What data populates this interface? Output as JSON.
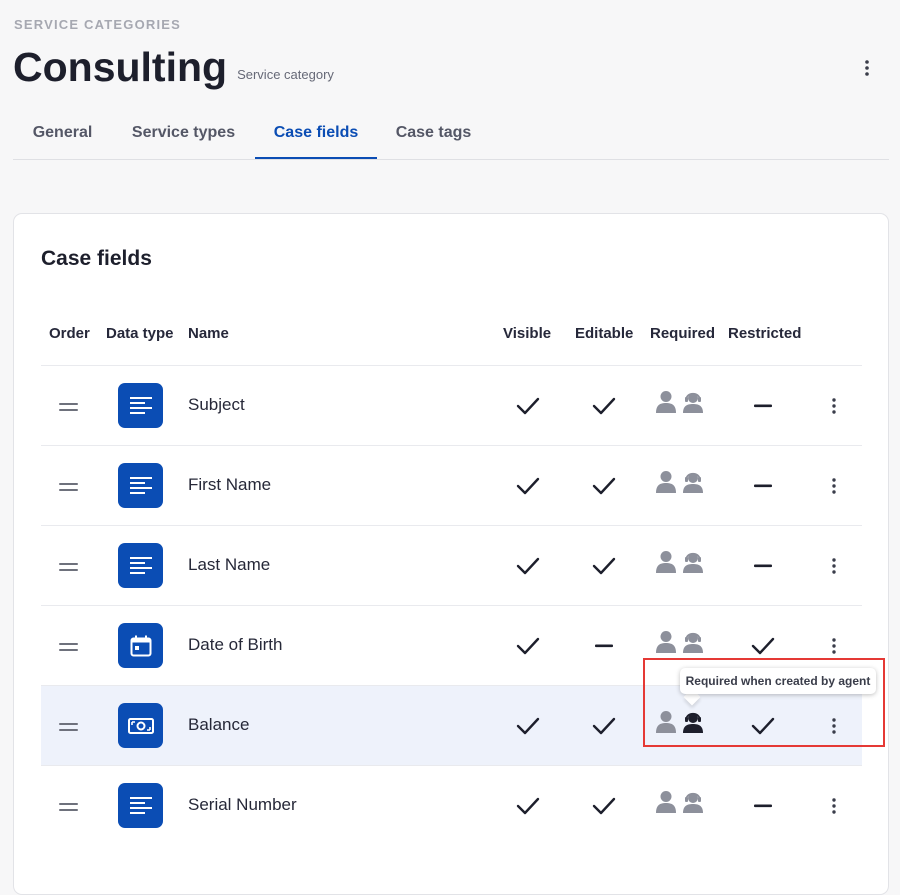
{
  "header": {
    "eyebrow": "SERVICE CATEGORIES",
    "title": "Consulting",
    "subtitle": "Service category"
  },
  "tabs": [
    {
      "label": "General",
      "active": false
    },
    {
      "label": "Service types",
      "active": false
    },
    {
      "label": "Case fields",
      "active": true
    },
    {
      "label": "Case tags",
      "active": false
    }
  ],
  "card": {
    "title": "Case fields",
    "columns": {
      "order": "Order",
      "data_type": "Data type",
      "name": "Name",
      "visible": "Visible",
      "editable": "Editable",
      "required": "Required",
      "restricted": "Restricted"
    },
    "rows": [
      {
        "name": "Subject",
        "data_type": "text-icon",
        "visible": true,
        "editable": true,
        "required_customer": false,
        "required_agent": false,
        "restricted": false
      },
      {
        "name": "First Name",
        "data_type": "text-icon",
        "visible": true,
        "editable": true,
        "required_customer": false,
        "required_agent": false,
        "restricted": false
      },
      {
        "name": "Last Name",
        "data_type": "text-icon",
        "visible": true,
        "editable": true,
        "required_customer": false,
        "required_agent": false,
        "restricted": false
      },
      {
        "name": "Date of Birth",
        "data_type": "calendar-icon",
        "visible": true,
        "editable": false,
        "required_customer": false,
        "required_agent": false,
        "restricted": true
      },
      {
        "name": "Balance",
        "data_type": "money-icon",
        "visible": true,
        "editable": true,
        "required_customer": false,
        "required_agent": true,
        "restricted": true
      },
      {
        "name": "Serial Number",
        "data_type": "text-icon",
        "visible": true,
        "editable": true,
        "required_customer": false,
        "required_agent": false,
        "restricted": false
      }
    ]
  },
  "tooltip": {
    "text": "Required when created by agent"
  },
  "colors": {
    "accent": "#0b4db4",
    "icon_inactive": "#8d909b",
    "icon_active": "#1d1f2c",
    "highlight_row": "#eef2fb",
    "annotation": "#e53935"
  }
}
